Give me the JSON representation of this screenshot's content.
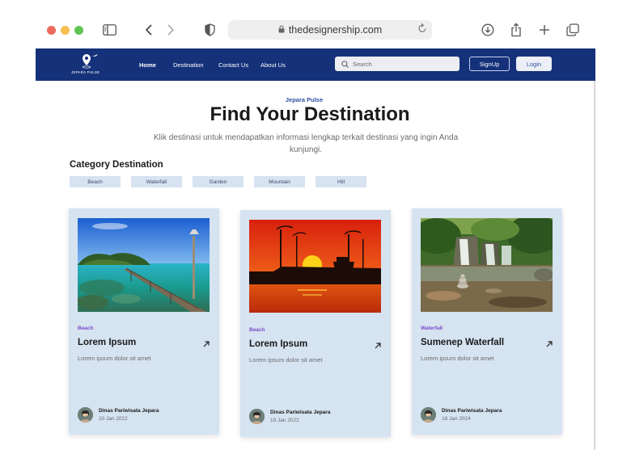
{
  "browser": {
    "url": "thedesignership.com"
  },
  "site": {
    "brand": "JEPARA PULSE",
    "nav": [
      {
        "label": "Home"
      },
      {
        "label": "Destination"
      },
      {
        "label": "Contact Us"
      },
      {
        "label": "About Us"
      }
    ],
    "search_placeholder": "Search",
    "signup_label": "SignUp",
    "login_label": "Login"
  },
  "hero": {
    "eyebrow": "Jepara Pulse",
    "title": "Find Your Destination",
    "subtitle": "Klik destinasi untuk mendapatkan informasi lengkap terkait destinasi yang ingin Anda kunjungi."
  },
  "categories": {
    "title": "Category Destination",
    "items": [
      "Beach",
      "Waterfall",
      "Garden",
      "Mountain",
      "Hill"
    ]
  },
  "cards": [
    {
      "category": "Beach",
      "title": "Lorem Ipsum",
      "description": "Lorem ipsum dolor sit amet",
      "author": "Dinas Pariwisata Jepara",
      "date": "20 Jan 2022",
      "image": "beach-pier-image"
    },
    {
      "category": "Beach",
      "title": "Lorem Ipsum",
      "description": "Lorem ipsum dolor sit amet",
      "author": "Dinas Pariwisata Jepara",
      "date": "19 Jan 2022",
      "image": "sunset-harbor-image"
    },
    {
      "category": "Waterfall",
      "title": "Sumenep Waterfall",
      "description": "Lorem ipsum dolor sit amet",
      "author": "Dinas Pariwisata Jepara",
      "date": "18 Jan 2024",
      "image": "waterfall-image"
    }
  ],
  "colors": {
    "nav_bg": "#15317a",
    "card_bg": "#d6e3f1",
    "chip_bg": "#d7e3f1",
    "accent_blue": "#2f4fa0",
    "tag_purple": "#7a4cc9"
  }
}
